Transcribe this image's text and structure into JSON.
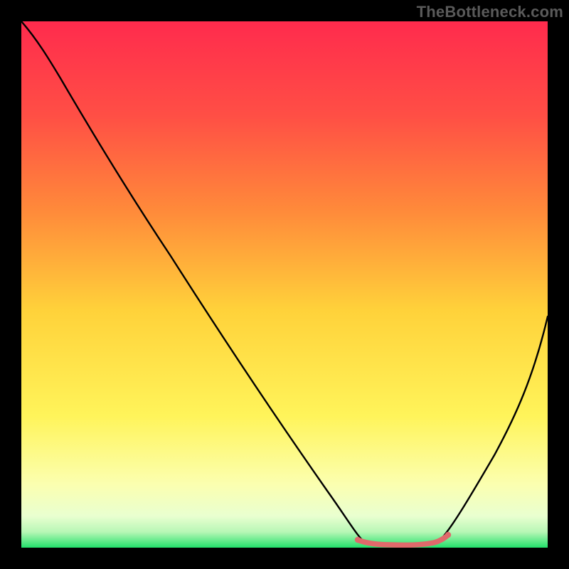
{
  "watermark": "TheBottleneck.com",
  "chart_data": {
    "type": "line",
    "title": "",
    "xlabel": "",
    "ylabel": "",
    "xlim": [
      0,
      100
    ],
    "ylim": [
      0,
      100
    ],
    "grid": false,
    "legend": false,
    "background_gradient": {
      "top": "#ff2b4d",
      "upper_mid": "#ff8a3a",
      "mid": "#ffd23a",
      "lower_mid": "#fff45a",
      "lower": "#faffd0",
      "bottom": "#22e06a"
    },
    "series": [
      {
        "name": "bottleneck-curve",
        "color": "#000000",
        "x": [
          0,
          5,
          10,
          15,
          20,
          25,
          30,
          35,
          40,
          45,
          50,
          55,
          60,
          62,
          65,
          68,
          72,
          75,
          78,
          80,
          85,
          90,
          95,
          100
        ],
        "y": [
          100,
          96,
          89,
          81,
          74,
          66,
          58,
          50,
          42,
          34,
          26,
          18,
          10,
          6,
          3,
          1,
          1,
          1,
          2,
          5,
          12,
          22,
          33,
          44
        ]
      },
      {
        "name": "good-range-highlight",
        "color": "#e0696b",
        "x": [
          62,
          65,
          68,
          72,
          75,
          78,
          80
        ],
        "y": [
          1.2,
          0.9,
          0.8,
          0.8,
          0.9,
          1.0,
          1.5
        ]
      }
    ]
  }
}
